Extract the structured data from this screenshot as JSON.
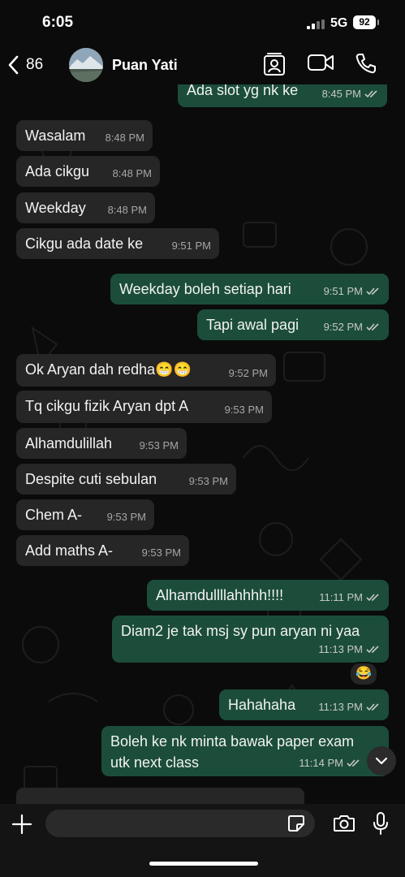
{
  "status_bar": {
    "time": "6:05",
    "network": "5G",
    "battery": "92"
  },
  "header": {
    "back_count": "86",
    "contact_name": "Puan Yati"
  },
  "messages": [
    {
      "dir": "out",
      "text": "Ada slot yg nk ke",
      "time": "8:45 PM",
      "read": true
    },
    {
      "dir": "in",
      "text": "Wasalam",
      "time": "8:48 PM"
    },
    {
      "dir": "in",
      "text": "Ada cikgu",
      "time": "8:48 PM"
    },
    {
      "dir": "in",
      "text": "Weekday",
      "time": "8:48 PM"
    },
    {
      "dir": "in",
      "text": "Cikgu ada date ke",
      "time": "9:51 PM"
    },
    {
      "dir": "out",
      "text": "Weekday boleh setiap hari",
      "time": "9:51 PM",
      "read": true
    },
    {
      "dir": "out",
      "text": "Tapi awal pagi",
      "time": "9:52 PM",
      "read": true
    },
    {
      "dir": "in",
      "text": "Ok Aryan dah redha😁😁",
      "time": "9:52 PM"
    },
    {
      "dir": "in",
      "text": "Tq cikgu fizik Aryan dpt A",
      "time": "9:53 PM"
    },
    {
      "dir": "in",
      "text": "Alhamdulillah",
      "time": "9:53 PM"
    },
    {
      "dir": "in",
      "text": "Despite cuti sebulan",
      "time": "9:53 PM"
    },
    {
      "dir": "in",
      "text": "Chem A-",
      "time": "9:53 PM"
    },
    {
      "dir": "in",
      "text": "Add maths A-",
      "time": "9:53 PM"
    },
    {
      "dir": "out",
      "text": "Alhamdullllahhhh!!!!",
      "time": "11:11 PM",
      "read": true
    },
    {
      "dir": "out",
      "text": "Diam2 je tak msj sy pun aryan ni yaa",
      "time": "11:13 PM",
      "read": true,
      "reaction": "😂"
    },
    {
      "dir": "out",
      "text": "Hahahaha",
      "time": "11:13 PM",
      "read": true
    },
    {
      "dir": "out",
      "text_lines": [
        "Boleh ke nk minta bawak paper exam",
        "utk next class"
      ],
      "time": "11:14 PM",
      "read": true
    },
    {
      "dir": "in",
      "text": "",
      "time": "",
      "partial": true
    }
  ],
  "input": {
    "placeholder": ""
  },
  "colors": {
    "incoming_bubble": "#262626",
    "outgoing_bubble": "#1b4d3a",
    "background": "#0b0b0b"
  }
}
